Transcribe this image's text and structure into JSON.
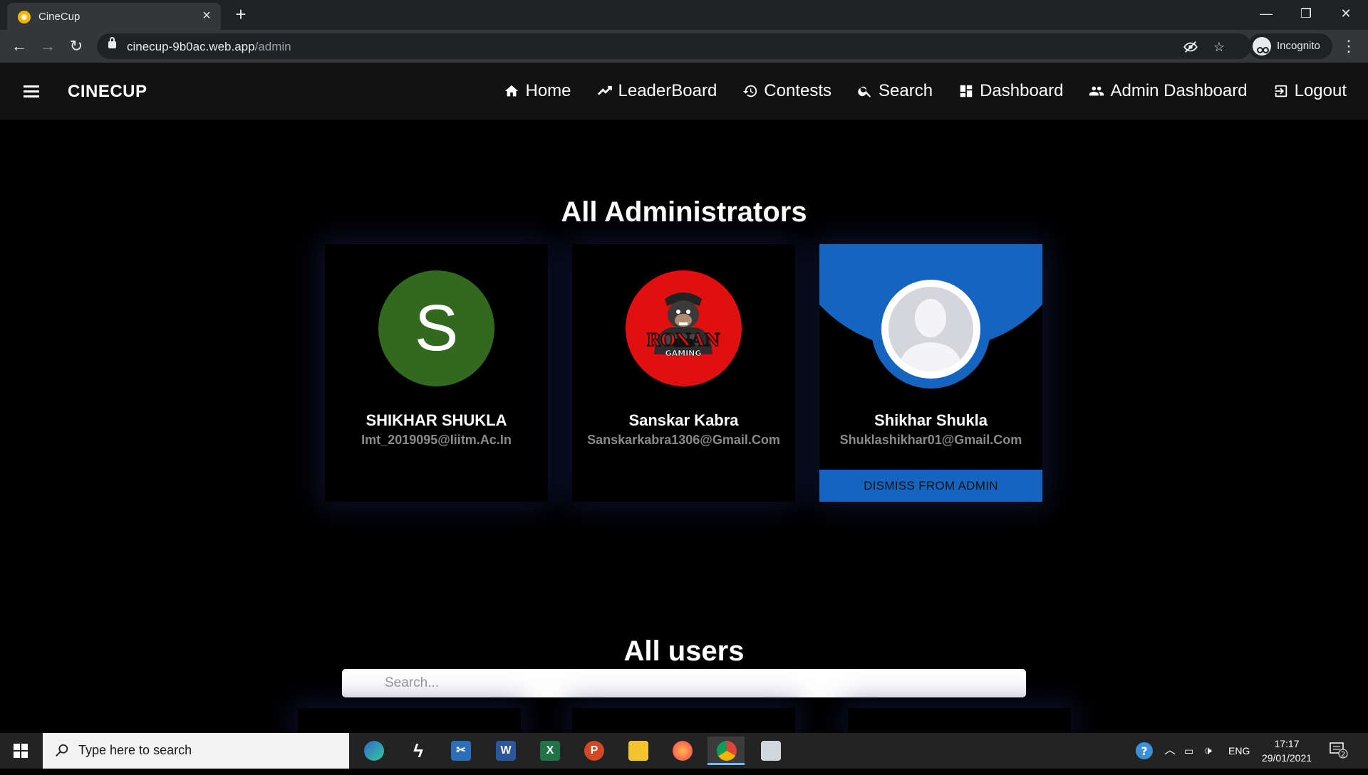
{
  "browser": {
    "tab_title": "CineCup",
    "url_host": "cinecup-9b0ac.web.app",
    "url_path": "/admin",
    "incognito_label": "Incognito"
  },
  "navbar": {
    "brand": "CINECUP",
    "links": [
      {
        "label": "Home",
        "icon": "home-icon"
      },
      {
        "label": "LeaderBoard",
        "icon": "trending-up-icon"
      },
      {
        "label": "Contests",
        "icon": "history-icon"
      },
      {
        "label": "Search",
        "icon": "search-icon"
      },
      {
        "label": "Dashboard",
        "icon": "dashboard-icon"
      },
      {
        "label": "Admin Dashboard",
        "icon": "people-icon"
      },
      {
        "label": "Logout",
        "icon": "logout-icon"
      }
    ]
  },
  "admins": {
    "title": "All Administrators",
    "cards": [
      {
        "name": "SHIKHAR SHUKLA",
        "email": "Imt_2019095@Iiitm.Ac.In",
        "avatar_letter": "S"
      },
      {
        "name": "Sanskar Kabra",
        "email": "Sanskarkabra1306@Gmail.Com",
        "avatar_text_1": "RONAN",
        "avatar_text_2": "GAMING"
      },
      {
        "name": "Shikhar Shukla",
        "email": "Shuklashikhar01@Gmail.Com",
        "action_label": "DISMISS FROM ADMIN"
      }
    ]
  },
  "users": {
    "title": "All users",
    "search_placeholder": "Search..."
  },
  "taskbar": {
    "search_placeholder": "Type here to search",
    "language": "ENG",
    "time": "17:17",
    "date": "29/01/2021",
    "notification_count": "2"
  },
  "colors": {
    "accent_blue": "#1565c0",
    "avatar_green": "#33691e",
    "avatar_red": "#e01010",
    "navbar_bg": "#121212"
  }
}
